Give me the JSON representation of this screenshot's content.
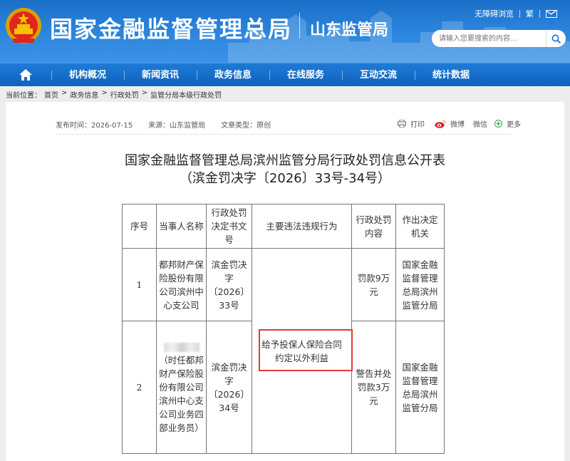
{
  "header": {
    "site_title": "国家金融监督管理总局",
    "sub_title": "山东监管局",
    "accessibility": "无障碍浏览",
    "traditional": "繁",
    "search_placeholder": "请输入您要搜索的内容..."
  },
  "nav": {
    "items": [
      "机构概况",
      "新闻资讯",
      "政务信息",
      "在线服务",
      "互动交流",
      "统计数据"
    ]
  },
  "breadcrumb": [
    "当前位置：",
    "首页",
    ">",
    "政务信息",
    ">",
    "行政处罚",
    ">",
    "监管分局本级行政处罚"
  ],
  "meta": {
    "publish_time": "发布时间：2026-07-15",
    "source": "来源：山东监管局",
    "doc_type": "文章类型：原创",
    "print": "打印",
    "weibo": "微博",
    "wechat": "微信",
    "more": "更多"
  },
  "article": {
    "title_line1": "国家金融监督管理总局滨州监管分局行政处罚信息公开表",
    "title_line2": "（滨金罚决字〔2026〕33号-34号）"
  },
  "table": {
    "headers": [
      "序号",
      "当事人名称",
      "行政处罚决定书文号",
      "主要违法违规行为",
      "行政处罚内容",
      "作出决定机关"
    ],
    "rows": [
      {
        "no": "1",
        "party": "都邦财产保险股份有限公司滨州中心支公司",
        "doc_no": "滨金罚决字〔2026〕33号",
        "penalty": "罚款9万元",
        "authority": "国家金融监督管理总局滨州监管分局"
      },
      {
        "no": "2",
        "party": "（时任都邦财产保险股份有限公司滨州中心支公司业务四部业务员）",
        "doc_no": "滨金罚决字〔2026〕34号",
        "penalty": "警告并处罚款3万元",
        "authority": "国家金融监督管理总局滨州监管分局"
      }
    ],
    "violation": "给予投保人保险合同约定以外利益"
  }
}
